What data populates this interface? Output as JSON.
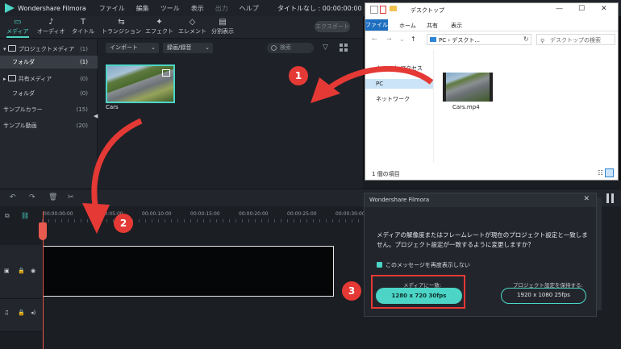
{
  "titlebar": {
    "app_name": "Wondershare Filmora",
    "menus": [
      "ファイル",
      "編集",
      "ツール",
      "表示",
      "出力",
      "ヘルプ"
    ],
    "project_title": "タイトルなし : 00:00:00:00"
  },
  "toolbar": {
    "tabs": [
      {
        "label": "メディア",
        "icon": "folder-icon"
      },
      {
        "label": "オーディオ",
        "icon": "music-note-icon"
      },
      {
        "label": "タイトル",
        "icon": "text-icon"
      },
      {
        "label": "トランジション",
        "icon": "transition-icon"
      },
      {
        "label": "エフェクト",
        "icon": "effects-icon"
      },
      {
        "label": "エレメント",
        "icon": "elements-icon"
      },
      {
        "label": "分割表示",
        "icon": "split-screen-icon"
      }
    ],
    "export_label": "エクスポート"
  },
  "sidebar": {
    "items": [
      {
        "label": "プロジェクトメディア",
        "count": "(1)"
      },
      {
        "label": "フォルダ",
        "count": "(1)"
      },
      {
        "label": "共有メディア",
        "count": "(0)"
      },
      {
        "label": "フォルダ",
        "count": "(0)"
      },
      {
        "label": "サンプルカラー",
        "count": "(15)"
      },
      {
        "label": "サンプル動画",
        "count": "(20)"
      }
    ]
  },
  "media_bar": {
    "import_label": "インポート",
    "record_label": "録画/録音",
    "search_placeholder": "検索"
  },
  "media": {
    "clip_name": "Cars"
  },
  "explorer": {
    "title": "デスクトップ",
    "ribbon_tabs": [
      "ファイル",
      "ホーム",
      "共有",
      "表示"
    ],
    "address": "PC › デスクト...",
    "search_placeholder": "デスクトップの検索",
    "tree": [
      "クイック アクセス",
      "PC",
      "ネットワーク"
    ],
    "file_name": "Cars.mp4",
    "status": "1 個の項目"
  },
  "timeline": {
    "ticks": [
      "00:00:00:00",
      "00:00:05:00",
      "00:00:10:00",
      "00:00:15:00",
      "00:00:20:00",
      "00:00:25:00",
      "00:00:30:00"
    ]
  },
  "dialog": {
    "title": "Wondershare Filmora",
    "message": "メディアの解像度またはフレームレートが現在のプロジェクト設定と一致しません。プロジェクト設定が一致するように変更しますか？",
    "dont_show_label": "このメッセージを再度表示しない",
    "match_media_label": "メディアに一致:",
    "match_media_button": "1280 x 720 30fps",
    "keep_settings_label": "プロジェクト設定を保持する:",
    "keep_settings_button": "1920 x 1080 25fps"
  },
  "steps": [
    "1",
    "2",
    "3"
  ],
  "colors": {
    "accent": "#4cd5c6",
    "marker": "#e53935"
  }
}
